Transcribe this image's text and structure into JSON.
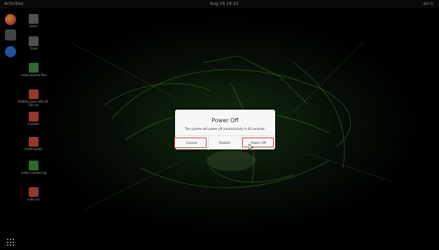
{
  "topbar": {
    "left": "Activities",
    "center": "Aug 18 14:33",
    "right": "en  ⏻"
  },
  "desktop_icons": [
    {
      "label": "Home",
      "color": "#6b6b6b"
    },
    {
      "label": "Trash",
      "color": "#6b6b6b"
    },
    {
      "label": "nvidia-backup-files",
      "color": "#3e8e3e"
    },
    {
      "label": "NVIDIA-Linux-x86_64-520.run",
      "color": "#c94a3a"
    },
    {
      "label": "Installer",
      "color": "#c94a3a"
    },
    {
      "label": "CUDA toolkit",
      "color": "#c94a3a"
    },
    {
      "label": "nvidia-installer.log",
      "color": "#3e8e3e"
    },
    {
      "label": "cuda.run",
      "color": "#c94a3a"
    }
  ],
  "dialog": {
    "title": "Power Off",
    "message": "The system will power off automatically in 60 seconds.",
    "cancel_label": "Cancel",
    "restart_label": "Restart",
    "poweroff_label": "Power Off"
  },
  "colors": {
    "highlight": "#d63b3b",
    "dialog_bg": "#f7f7f7",
    "accent_green": "#6fdc3c"
  }
}
